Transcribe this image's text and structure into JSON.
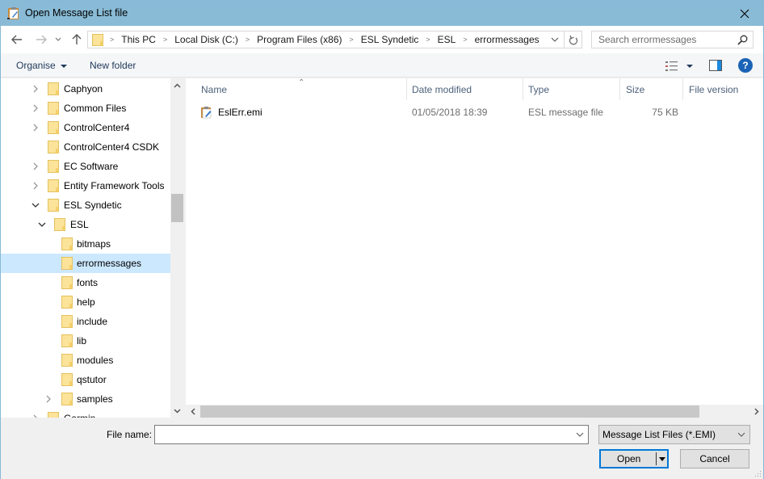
{
  "window": {
    "title": "Open Message List file"
  },
  "navigation": {
    "back_label": "Back",
    "forward_label": "Forward",
    "recent_label": "Recent locations",
    "up_label": "Up",
    "breadcrumbs": [
      "This PC",
      "Local Disk (C:)",
      "Program Files (x86)",
      "ESL Syndetic",
      "ESL",
      "errormessages"
    ],
    "search_placeholder": "Search errormessages"
  },
  "toolbar": {
    "organise_label": "Organise",
    "new_folder_label": "New folder",
    "help_label": "?"
  },
  "tree": {
    "items": [
      {
        "label": "Caphyon",
        "level": 1,
        "expander": "collapsed"
      },
      {
        "label": "Common Files",
        "level": 1,
        "expander": "collapsed"
      },
      {
        "label": "ControlCenter4",
        "level": 1,
        "expander": "collapsed"
      },
      {
        "label": "ControlCenter4 CSDK",
        "level": 1,
        "expander": "none"
      },
      {
        "label": "EC Software",
        "level": 1,
        "expander": "collapsed"
      },
      {
        "label": "Entity Framework Tools",
        "level": 1,
        "expander": "collapsed"
      },
      {
        "label": "ESL Syndetic",
        "level": 1,
        "expander": "expanded"
      },
      {
        "label": "ESL",
        "level": 2,
        "expander": "expanded"
      },
      {
        "label": "bitmaps",
        "level": 3,
        "expander": "none"
      },
      {
        "label": "errormessages",
        "level": 3,
        "expander": "none",
        "selected": true
      },
      {
        "label": "fonts",
        "level": 3,
        "expander": "none"
      },
      {
        "label": "help",
        "level": 3,
        "expander": "none"
      },
      {
        "label": "include",
        "level": 3,
        "expander": "none"
      },
      {
        "label": "lib",
        "level": 3,
        "expander": "none"
      },
      {
        "label": "modules",
        "level": 3,
        "expander": "none"
      },
      {
        "label": "qstutor",
        "level": 3,
        "expander": "none"
      },
      {
        "label": "samples",
        "level": 3,
        "expander": "collapsed"
      },
      {
        "label": "Garmin",
        "level": 1,
        "expander": "collapsed"
      }
    ]
  },
  "file_list": {
    "columns": [
      "Name",
      "Date modified",
      "Type",
      "Size",
      "File version"
    ],
    "sort_column": "Name",
    "rows": [
      {
        "name": "EslErr.emi",
        "date_modified": "01/05/2018 18:39",
        "type": "ESL message file",
        "size": "75 KB",
        "file_version": ""
      }
    ]
  },
  "bottom": {
    "file_name_label": "File name:",
    "file_name_value": "",
    "file_type_selected": "Message List Files (*.EMI)",
    "open_label": "Open",
    "cancel_label": "Cancel"
  },
  "colors": {
    "titlebar": "#89bbd6",
    "selection": "#cce8ff",
    "accent": "#0078d7",
    "folder": "#f8d775"
  }
}
